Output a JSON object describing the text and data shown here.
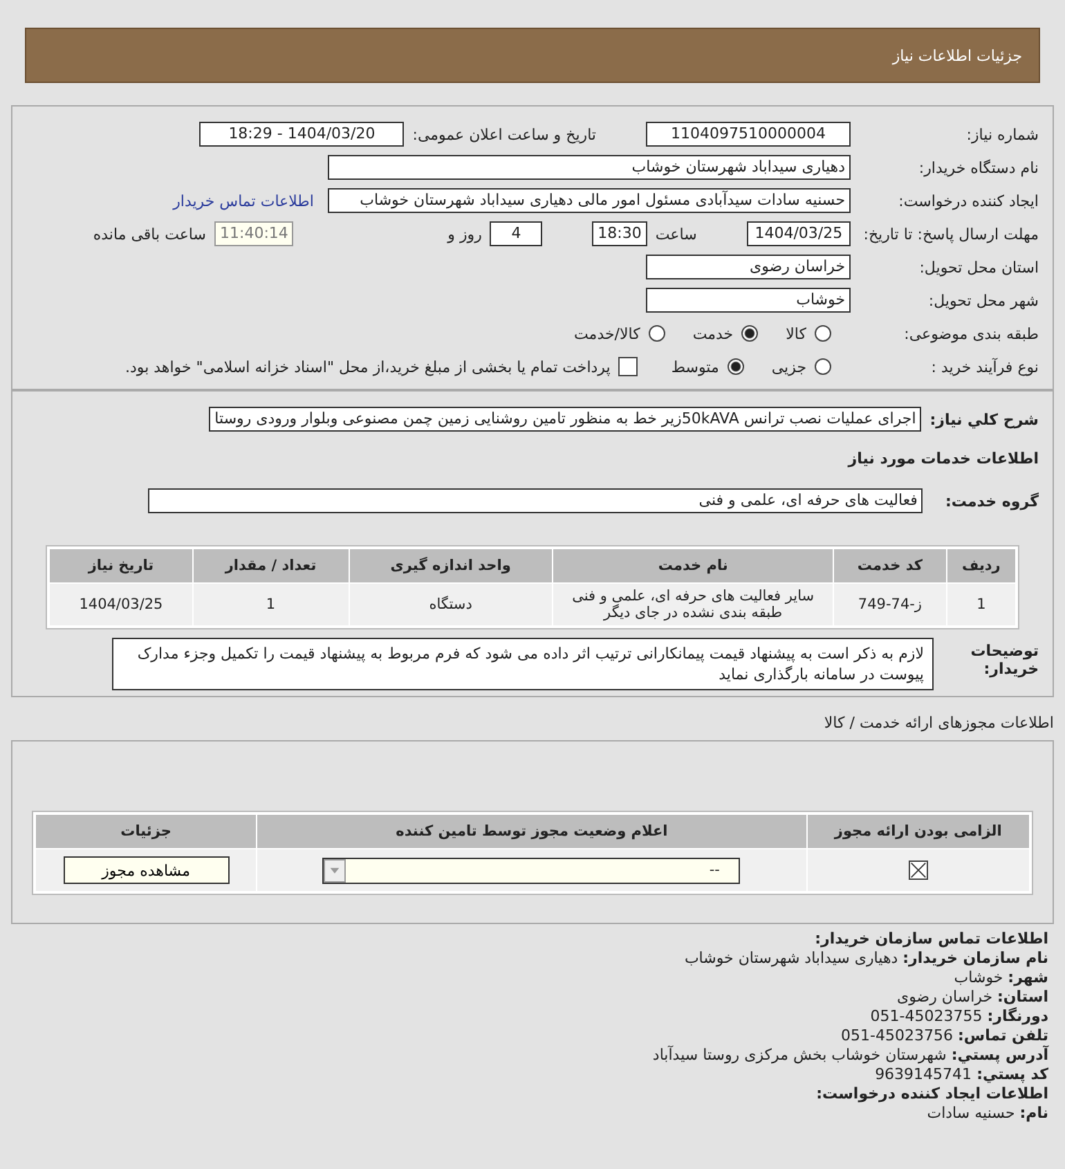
{
  "header": {
    "title": "جزئیات اطلاعات نیاز"
  },
  "details": {
    "need_number": {
      "label": "شماره نیاز:",
      "value": "1104097510000004"
    },
    "announce": {
      "label": "تاریخ و ساعت اعلان عمومی:",
      "value": "1404/03/20 - 18:29"
    },
    "buyer": {
      "label": "نام دستگاه خریدار:",
      "value": "دهیاری سیداباد شهرستان خوشاب"
    },
    "creator": {
      "label": "ایجاد کننده درخواست:",
      "value": "حسنیه سادات سیدآبادی مسئول امور مالی دهیاری سیداباد شهرستان خوشاب",
      "link": "اطلاعات تماس خریدار"
    },
    "deadline": {
      "label": "مهلت ارسال پاسخ: تا تاریخ:",
      "date": "1404/03/25",
      "time_label": "ساعت",
      "time": "18:30",
      "days": "4",
      "days_label": "روز و",
      "remaining": "11:40:14",
      "remaining_label": "ساعت باقی مانده"
    },
    "province": {
      "label": "استان محل تحویل:",
      "value": "خراسان رضوی"
    },
    "city": {
      "label": "شهر محل تحویل:",
      "value": "خوشاب"
    },
    "category": {
      "label": "طبقه بندی موضوعی:",
      "options": [
        {
          "label": "کالا",
          "selected": false
        },
        {
          "label": "خدمت",
          "selected": true
        },
        {
          "label": "کالا/خدمت",
          "selected": false
        }
      ]
    },
    "process": {
      "label": "نوع فرآیند خرید :",
      "options": [
        {
          "label": "جزیی",
          "selected": false
        },
        {
          "label": "متوسط",
          "selected": true
        }
      ],
      "payment": {
        "label": "پرداخت تمام یا بخشی از مبلغ خرید،از محل \"اسناد خزانه اسلامی\" خواهد بود.",
        "checked": false
      }
    }
  },
  "need": {
    "summary": {
      "label": "شرح کلي نياز:",
      "value": "اجرای عملیات نصب ترانس 50kAVAزیر خط به منظور تامین روشنایی زمین چمن مصنوعی وبلوار ورودی روستا"
    },
    "services_heading": "اطلاعات خدمات مورد نیاز",
    "group": {
      "label": "گروه خدمت:",
      "value": "فعالیت های حرفه ای، علمی و فنی"
    },
    "table": {
      "columns": [
        "ردیف",
        "کد خدمت",
        "نام خدمت",
        "واحد اندازه گیری",
        "تعداد / مقدار",
        "تاریخ نیاز"
      ],
      "rows": [
        [
          "1",
          "ز-74-749",
          "سایر فعالیت های حرفه ای، علمی و فنی طبقه بندی نشده در جای دیگر",
          "دستگاه",
          "1",
          "1404/03/25"
        ]
      ]
    },
    "notes": {
      "label": "توضیحات خریدار:",
      "value": "لازم به ذکر است به پیشنهاد قیمت پیمانکارانی ترتیب اثر داده می شود که فرم مربوط به پیشنهاد قیمت را تکمیل وجزء مدارک پیوست در سامانه بارگذاری نماید"
    }
  },
  "permits": {
    "title": "اطلاعات مجوزهای ارائه خدمت / کالا",
    "columns": [
      "الزامی بودن ارائه مجوز",
      "اعلام وضعیت مجوز توسط تامین کننده",
      "جزئیات"
    ],
    "rows": [
      {
        "required": true,
        "status": "--",
        "button": "مشاهده مجوز"
      }
    ]
  },
  "contact": [
    {
      "kind": "heading",
      "label": "اطلاعات تماس سازمان خریدار:"
    },
    {
      "kind": "field",
      "label": "نام سازمان خریدار:",
      "value": "دهیاری سیداباد شهرستان خوشاب"
    },
    {
      "kind": "field",
      "label": "شهر:",
      "value": "خوشاب"
    },
    {
      "kind": "field",
      "label": "استان:",
      "value": "خراسان رضوی"
    },
    {
      "kind": "field",
      "label": "دورنگار:",
      "value": "45023755-051"
    },
    {
      "kind": "field",
      "label": "تلفن تماس:",
      "value": "45023756-051"
    },
    {
      "kind": "field",
      "label": "آدرس پستي:",
      "value": "شهرستان خوشاب بخش مرکزی روستا سیدآباد"
    },
    {
      "kind": "field",
      "label": "کد پستي:",
      "value": "9639145741"
    },
    {
      "kind": "heading",
      "label": "اطلاعات ایجاد کننده درخواست:"
    },
    {
      "kind": "field",
      "label": "نام:",
      "value": "حسنیه سادات"
    }
  ]
}
